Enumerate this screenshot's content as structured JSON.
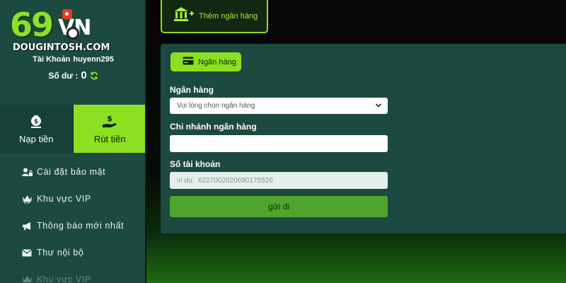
{
  "brand": {
    "logo_number": "69",
    "logo_suffix": "VN",
    "domain": "DOUGINTOSH.COM"
  },
  "account": {
    "label": "Tài Khoản",
    "username": "huyenn295",
    "balance_label": "Số dư :",
    "balance_value": "0"
  },
  "actions": {
    "deposit_label": "Nạp tiền",
    "withdraw_label": "Rút tiền"
  },
  "menu": {
    "items": [
      {
        "label": "Cài đặt bảo mật",
        "icon": "user-lock-icon"
      },
      {
        "label": "Khu vực VIP",
        "icon": "vip-crown-icon"
      },
      {
        "label": "Thông báo mới nhất",
        "icon": "megaphone-icon"
      },
      {
        "label": "Thư nội bộ",
        "icon": "envelope-icon"
      },
      {
        "label": "Khu vực VIP",
        "icon": "vip-crown-icon"
      }
    ]
  },
  "tab": {
    "add_bank_label": "Thêm ngân hàng"
  },
  "form": {
    "tag_label": "Ngân hàng",
    "bank_label": "Ngân hàng",
    "bank_select_value": "Vui lòng chọn ngân hàng",
    "branch_label": "Chi nhánh ngân hàng",
    "branch_value": "",
    "account_label": "Số tài khoản",
    "account_placeholder": "ví dụ:  6227002020690175526",
    "submit_label": "gửi đi"
  },
  "colors": {
    "accent": "#8de021",
    "panel": "#1d4a40",
    "sidebar": "#1d4a40",
    "submit": "#50a52e"
  }
}
